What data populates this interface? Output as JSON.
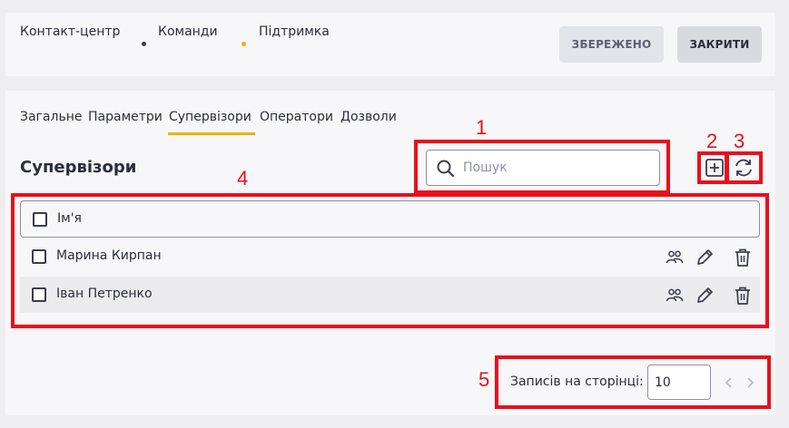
{
  "header": {
    "breadcrumbs": [
      "Контакт-центр",
      "Команди",
      "Підтримка"
    ],
    "breadcrumb_dot_colors": [
      "#3a3c4e",
      "#f2b300"
    ],
    "saved_button": "ЗБЕРЕЖЕНО",
    "close_button": "ЗАКРИТИ"
  },
  "tabs": [
    "Загальне",
    "Параметри",
    "Супервізори",
    "Оператори",
    "Дозволи"
  ],
  "active_tab": "Супервізори",
  "accent_color": "#f2b300",
  "section_title": "Супервізори",
  "search": {
    "placeholder": "Пошук",
    "icon": "search-icon"
  },
  "actions": {
    "add_icon": "add-square-icon",
    "refresh_icon": "refresh-icon"
  },
  "table": {
    "header": "Ім'я",
    "rows": [
      {
        "name": "Марина Кирпан"
      },
      {
        "name": "Іван Петренко"
      }
    ],
    "row_icons": [
      "users-icon",
      "pencil-icon",
      "trash-icon"
    ]
  },
  "pagination": {
    "label": "Записів на сторінці:",
    "value": "10"
  },
  "annotations": [
    "1",
    "2",
    "3",
    "4",
    "5"
  ],
  "annotation_color": "#e8101c"
}
